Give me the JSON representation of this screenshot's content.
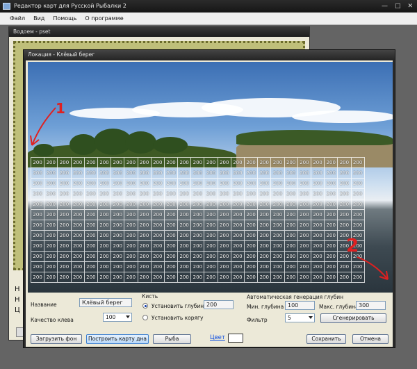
{
  "app": {
    "title": "Редактор карт для Русской Рыбалки 2",
    "controls": {
      "minimize": "—",
      "maximize": "□",
      "close": "✕"
    }
  },
  "menu": [
    "Файл",
    "Вид",
    "Помощь",
    "О программе"
  ],
  "back_window": {
    "title": "Водоем - pset",
    "side_letters": [
      "Н",
      "Н",
      "Ц"
    ]
  },
  "dialog": {
    "title": "Локация - Клёвый берег",
    "grid": {
      "rows": 12,
      "cols": 25,
      "value": "200"
    },
    "annotations": {
      "mark1": "1",
      "mark2": "2"
    },
    "form": {
      "name_label": "Название",
      "name_value": "Клёвый берег",
      "quality_label": "Качество клева",
      "quality_value": "100",
      "brush_group": "Кисть",
      "set_depth_label": "Установить глубину",
      "set_depth_value": "200",
      "set_snag_label": "Установить корягу",
      "autogen_group": "Автоматическая генерация глубин",
      "min_depth_label": "Мин. глубина",
      "min_depth_value": "100",
      "max_depth_label": "Макс. глубина",
      "max_depth_value": "300",
      "filter_label": "Фильтр",
      "filter_value": "5",
      "generate_button": "Сгенерировать"
    },
    "buttons": {
      "load_bg": "Загрузить фон",
      "build_map": "Построить карту дна",
      "fish": "Рыба",
      "color_link": "Цвет",
      "save": "Сохранить",
      "cancel": "Отмена"
    },
    "colors": {
      "color_swatch": "#ffffff",
      "annotation": "#e02020",
      "active_button": "#b9d8f8"
    }
  }
}
